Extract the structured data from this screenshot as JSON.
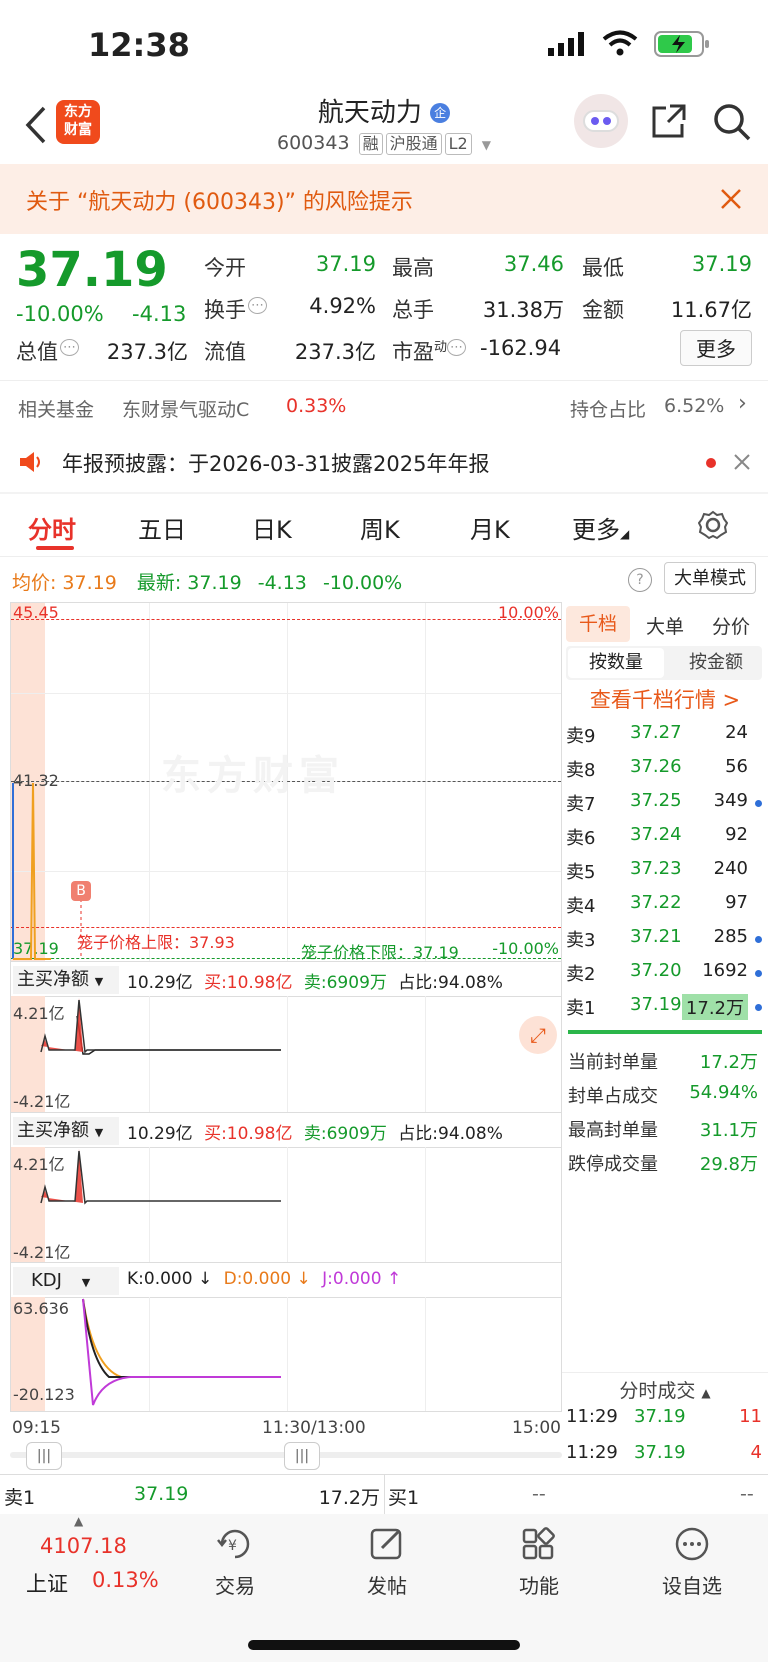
{
  "status_bar": {
    "time": "12:38"
  },
  "header": {
    "title": "航天动力",
    "code": "600343",
    "tags": [
      "融",
      "沪股通",
      "L2"
    ],
    "logo_text": "东方财富"
  },
  "risk_banner": {
    "text": "关于 “航天动力 (600343)” 的风险提示"
  },
  "quote": {
    "price": "37.19",
    "change_pct": "-10.00%",
    "change": "-4.13",
    "open_label": "今开",
    "open": "37.19",
    "high_label": "最高",
    "high": "37.46",
    "low_label": "最低",
    "low": "37.19",
    "turnover_label": "换手",
    "turnover": "4.92%",
    "volume_label": "总手",
    "volume": "31.38万",
    "amount_label": "金额",
    "amount": "11.67亿",
    "mktcap_label": "总值",
    "mktcap": "237.3亿",
    "float_label": "流值",
    "float": "237.3亿",
    "pe_label": "市盈",
    "pe_sup": "动",
    "pe": "-162.94",
    "more_button": "更多"
  },
  "fund_row": {
    "label": "相关基金",
    "fund_name": "东财景气驱动C",
    "fund_pct": "0.33%",
    "holding_label": "持仓占比",
    "holding_pct": "6.52%"
  },
  "notice": {
    "text": "年报预披露：于2026-03-31披露2025年年报"
  },
  "chart_tabs": [
    "分时",
    "五日",
    "日K",
    "周K",
    "月K",
    "更多"
  ],
  "chart_info": {
    "avg_label": "均价:",
    "avg": "37.19",
    "latest_label": "最新:",
    "latest": "37.19",
    "latest_chg": "-4.13",
    "latest_pct": "-10.00%",
    "big_order_mode": "大单模式"
  },
  "main_chart": {
    "y_top": "45.45",
    "y_mid": "41.32",
    "y_bottom": "37.19",
    "pct_top": "10.00%",
    "pct_bottom": "-10.00%",
    "cage_upper": "笼子价格上限：37.93",
    "cage_lower": "笼子价格下限：37.19",
    "marker": "B",
    "watermark": "东方财富"
  },
  "indicator1": {
    "selector": "主买净额",
    "net": "10.29亿",
    "buy": "买:10.98亿",
    "sell": "卖:6909万",
    "ratio": "占比:94.08%",
    "y_top": "4.21亿",
    "y_bottom": "-4.21亿"
  },
  "indicator2": {
    "selector": "主买净额",
    "net": "10.29亿",
    "buy": "买:10.98亿",
    "sell": "卖:6909万",
    "ratio": "占比:94.08%",
    "y_top": "4.21亿",
    "y_bottom": "-4.21亿"
  },
  "kdj": {
    "selector": "KDJ",
    "k": "K:0.000 ↓",
    "d": "D:0.000 ↓",
    "j": "J:0.000 ↑",
    "y_top": "63.636",
    "y_bottom": "-20.123"
  },
  "time_axis": {
    "start": "09:15",
    "mid": "11:30/13:00",
    "end": "15:00"
  },
  "order_book": {
    "tabs": [
      "千档",
      "大单",
      "分价"
    ],
    "subtabs": [
      "按数量",
      "按金额"
    ],
    "link": "查看千档行情 >",
    "asks": [
      {
        "label": "卖9",
        "price": "37.27",
        "qty": "24",
        "dot": false
      },
      {
        "label": "卖8",
        "price": "37.26",
        "qty": "56",
        "dot": false
      },
      {
        "label": "卖7",
        "price": "37.25",
        "qty": "349",
        "dot": true
      },
      {
        "label": "卖6",
        "price": "37.24",
        "qty": "92",
        "dot": false
      },
      {
        "label": "卖5",
        "price": "37.23",
        "qty": "240",
        "dot": false
      },
      {
        "label": "卖4",
        "price": "37.22",
        "qty": "97",
        "dot": false
      },
      {
        "label": "卖3",
        "price": "37.21",
        "qty": "285",
        "dot": true
      },
      {
        "label": "卖2",
        "price": "37.20",
        "qty": "1692",
        "dot": true
      },
      {
        "label": "卖1",
        "price": "37.19",
        "qty": "17.2万",
        "dot": true
      }
    ],
    "stats": [
      {
        "label": "当前封单量",
        "value": "17.2万"
      },
      {
        "label": "封单占成交",
        "value": "54.94%"
      },
      {
        "label": "最高封单量",
        "value": "31.1万"
      },
      {
        "label": "跌停成交量",
        "value": "29.8万"
      }
    ],
    "trades_header": "分时成交",
    "trades": [
      {
        "time": "11:29",
        "price": "37.19",
        "qty": "11"
      },
      {
        "time": "11:29",
        "price": "37.19",
        "qty": "4"
      }
    ]
  },
  "bottom_quote": {
    "sell1_label": "卖1",
    "sell1_price": "37.19",
    "sell1_qty": "17.2万",
    "buy1_label": "买1",
    "buy1_price": "--",
    "buy1_qty": "--"
  },
  "bottom_nav": {
    "index_value": "4107.18",
    "index_name": "上证",
    "index_pct": "0.13%",
    "items": [
      "交易",
      "发帖",
      "功能",
      "设自选"
    ]
  },
  "colors": {
    "up": "#e8322a",
    "down": "#159a2b",
    "accent": "#e8591a"
  }
}
